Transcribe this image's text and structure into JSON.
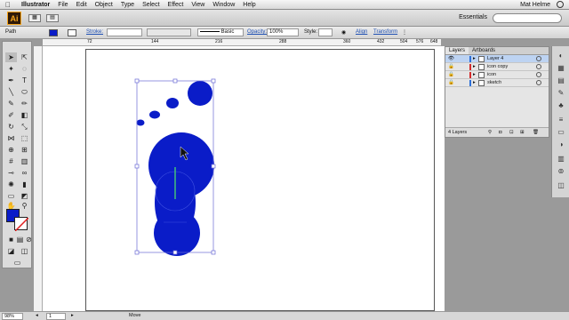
{
  "menubar": {
    "app_name": "Illustrator",
    "items": [
      "File",
      "Edit",
      "Object",
      "Type",
      "Select",
      "Effect",
      "View",
      "Window",
      "Help"
    ],
    "user": "Mat Helme"
  },
  "appbar": {
    "logo_text": "Ai",
    "workspace": "Essentials"
  },
  "control_bar": {
    "selection_label": "Path",
    "stroke_label": "Stroke:",
    "brush_label": "Basic",
    "opacity_label": "Opacity:",
    "opacity_value": "100%",
    "style_label": "Style:",
    "align_link": "Align",
    "transform_link": "Transform"
  },
  "ruler": {
    "ticks": [
      "72",
      "144",
      "216",
      "288",
      "360",
      "432",
      "504",
      "576",
      "648"
    ]
  },
  "layers_panel": {
    "tabs": [
      "Layers",
      "Artboards"
    ],
    "layers": [
      {
        "name": "Layer 4",
        "color": "#2c6fd8",
        "selected": true
      },
      {
        "name": "icon copy",
        "color": "#d42b2b",
        "selected": false
      },
      {
        "name": "icon",
        "color": "#d42b2b",
        "selected": false
      },
      {
        "name": "sketch",
        "color": "#2c6fd8",
        "selected": false
      }
    ],
    "count_label": "4 Layers"
  },
  "status_bar": {
    "zoom": "98%",
    "artboard_number": "1",
    "tool_status": "Move"
  },
  "colors": {
    "fill": "#0a1cc8",
    "selection": "#6b6bd6",
    "canvas": "#ffffff"
  }
}
